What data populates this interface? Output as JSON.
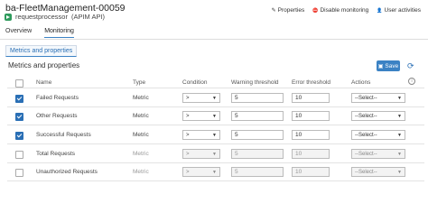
{
  "header": {
    "title": "ba-FleetManagement-00059",
    "subtitle": "requestprocessor",
    "subtitle_type": "(APIM API)",
    "links": [
      {
        "icon": "✎",
        "label": "Properties"
      },
      {
        "icon": "⛔",
        "label": "Disable monitoring"
      },
      {
        "icon": "👤",
        "label": "User activities"
      }
    ]
  },
  "tabs": [
    {
      "label": "Overview",
      "active": false
    },
    {
      "label": "Monitoring",
      "active": true
    }
  ],
  "subtab": "Metrics and properties",
  "section_title": "Metrics and properties",
  "save_label": "Save",
  "columns": {
    "name": "Name",
    "type": "Type",
    "condition": "Condition",
    "warning": "Warning threshold",
    "error": "Error threshold",
    "actions": "Actions"
  },
  "rows": [
    {
      "name": "Failed Requests",
      "type": "Metric",
      "condition": ">",
      "warning": "5",
      "error": "10",
      "action": "--Select--",
      "checked": true
    },
    {
      "name": "Other Requests",
      "type": "Metric",
      "condition": ">",
      "warning": "5",
      "error": "10",
      "action": "--Select--",
      "checked": true
    },
    {
      "name": "Successful Requests",
      "type": "Metric",
      "condition": ">",
      "warning": "5",
      "error": "10",
      "action": "--Select--",
      "checked": true
    },
    {
      "name": "Total Requests",
      "type": "Metric",
      "condition": ">",
      "warning": "5",
      "error": "10",
      "action": "--Select--",
      "checked": false
    },
    {
      "name": "Unauthorized Requests",
      "type": "Metric",
      "condition": ">",
      "warning": "5",
      "error": "10",
      "action": "--Select--",
      "checked": false
    }
  ]
}
